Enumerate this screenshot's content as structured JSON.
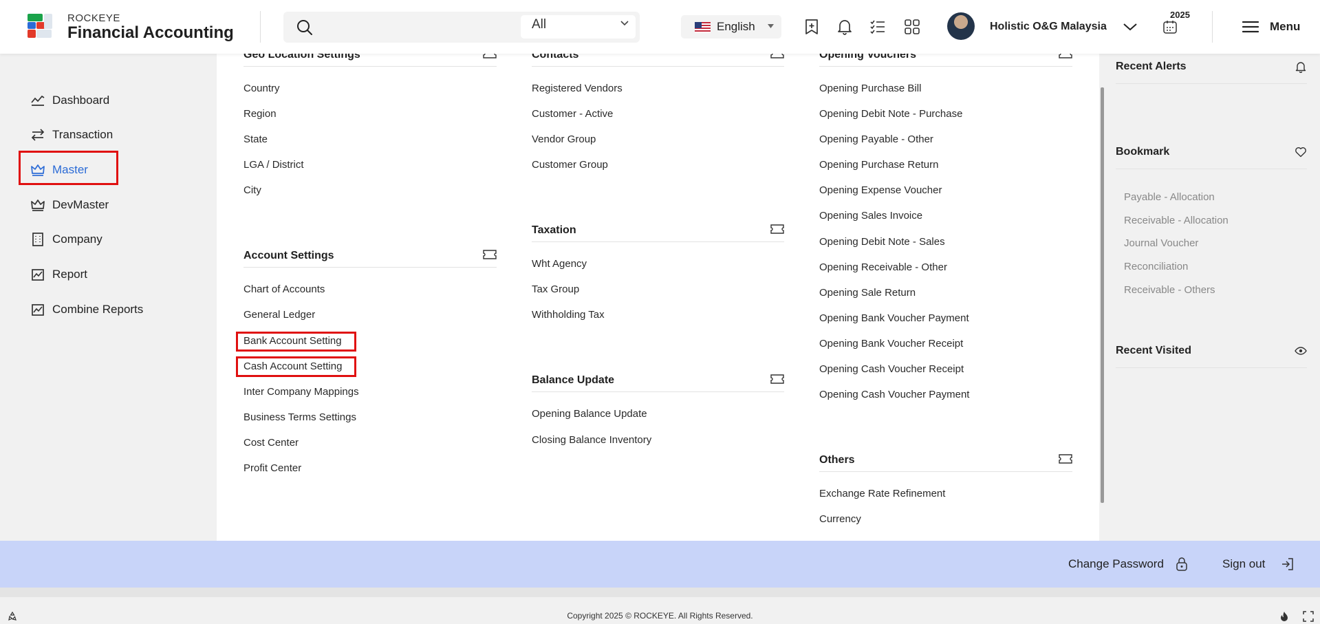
{
  "header": {
    "brand_small": "ROCKEYE",
    "brand_big": "Financial Accounting",
    "search_placeholder": "",
    "scope_value": "All",
    "language": "English",
    "company": "Holistic O&G Malaysia",
    "year": "2025",
    "menu_label": "Menu"
  },
  "nav": {
    "items": [
      {
        "label": "Dashboard",
        "icon": "chart-line-icon"
      },
      {
        "label": "Transaction",
        "icon": "transfer-arrows-icon"
      },
      {
        "label": "Master",
        "icon": "crown-icon",
        "active": true
      },
      {
        "label": "DevMaster",
        "icon": "crown-icon"
      },
      {
        "label": "Company",
        "icon": "building-icon"
      },
      {
        "label": "Report",
        "icon": "report-chart-icon"
      },
      {
        "label": "Combine Reports",
        "icon": "report-chart-icon"
      }
    ]
  },
  "panel": {
    "geo": {
      "title": "Geo Location Settings",
      "items": [
        "Country",
        "Region",
        "State",
        "LGA / District",
        "City"
      ]
    },
    "account": {
      "title": "Account Settings",
      "items": [
        "Chart of Accounts",
        "General Ledger",
        "Bank Account Setting",
        "Cash Account Setting",
        "Inter Company Mappings",
        "Business Terms Settings",
        "Cost Center",
        "Profit Center"
      ]
    },
    "contacts": {
      "title": "Contacts",
      "items": [
        "Registered Vendors",
        "Customer - Active",
        "Vendor Group",
        "Customer Group"
      ]
    },
    "taxation": {
      "title": "Taxation",
      "items": [
        "Wht Agency",
        "Tax Group",
        "Withholding Tax"
      ]
    },
    "balance": {
      "title": "Balance Update",
      "items": [
        "Opening Balance Update",
        "Closing Balance Inventory"
      ]
    },
    "opening": {
      "title": "Opening Vouchers",
      "items": [
        "Opening Purchase Bill",
        "Opening Debit Note - Purchase",
        "Opening Payable - Other",
        "Opening Purchase Return",
        "Opening Expense Voucher",
        "Opening Sales Invoice",
        "Opening Debit Note - Sales",
        "Opening Receivable - Other",
        "Opening Sale Return",
        "Opening Bank Voucher Payment",
        "Opening Bank Voucher Receipt",
        "Opening Cash Voucher Receipt",
        "Opening Cash Voucher Payment"
      ]
    },
    "others": {
      "title": "Others",
      "items": [
        "Exchange Rate Refinement",
        "Currency"
      ]
    }
  },
  "right_sidebar": {
    "alerts_title": "Recent Alerts",
    "bookmark_title": "Bookmark",
    "bookmarks": [
      "Payable - Allocation",
      "Receivable - Allocation",
      "Journal Voucher",
      "Reconciliation",
      "Receivable - Others"
    ],
    "visited_title": "Recent Visited"
  },
  "footer": {
    "change_password": "Change Password",
    "sign_out": "Sign out",
    "copyright": "Copyright 2025 © ROCKEYE. All Rights Reserved."
  }
}
